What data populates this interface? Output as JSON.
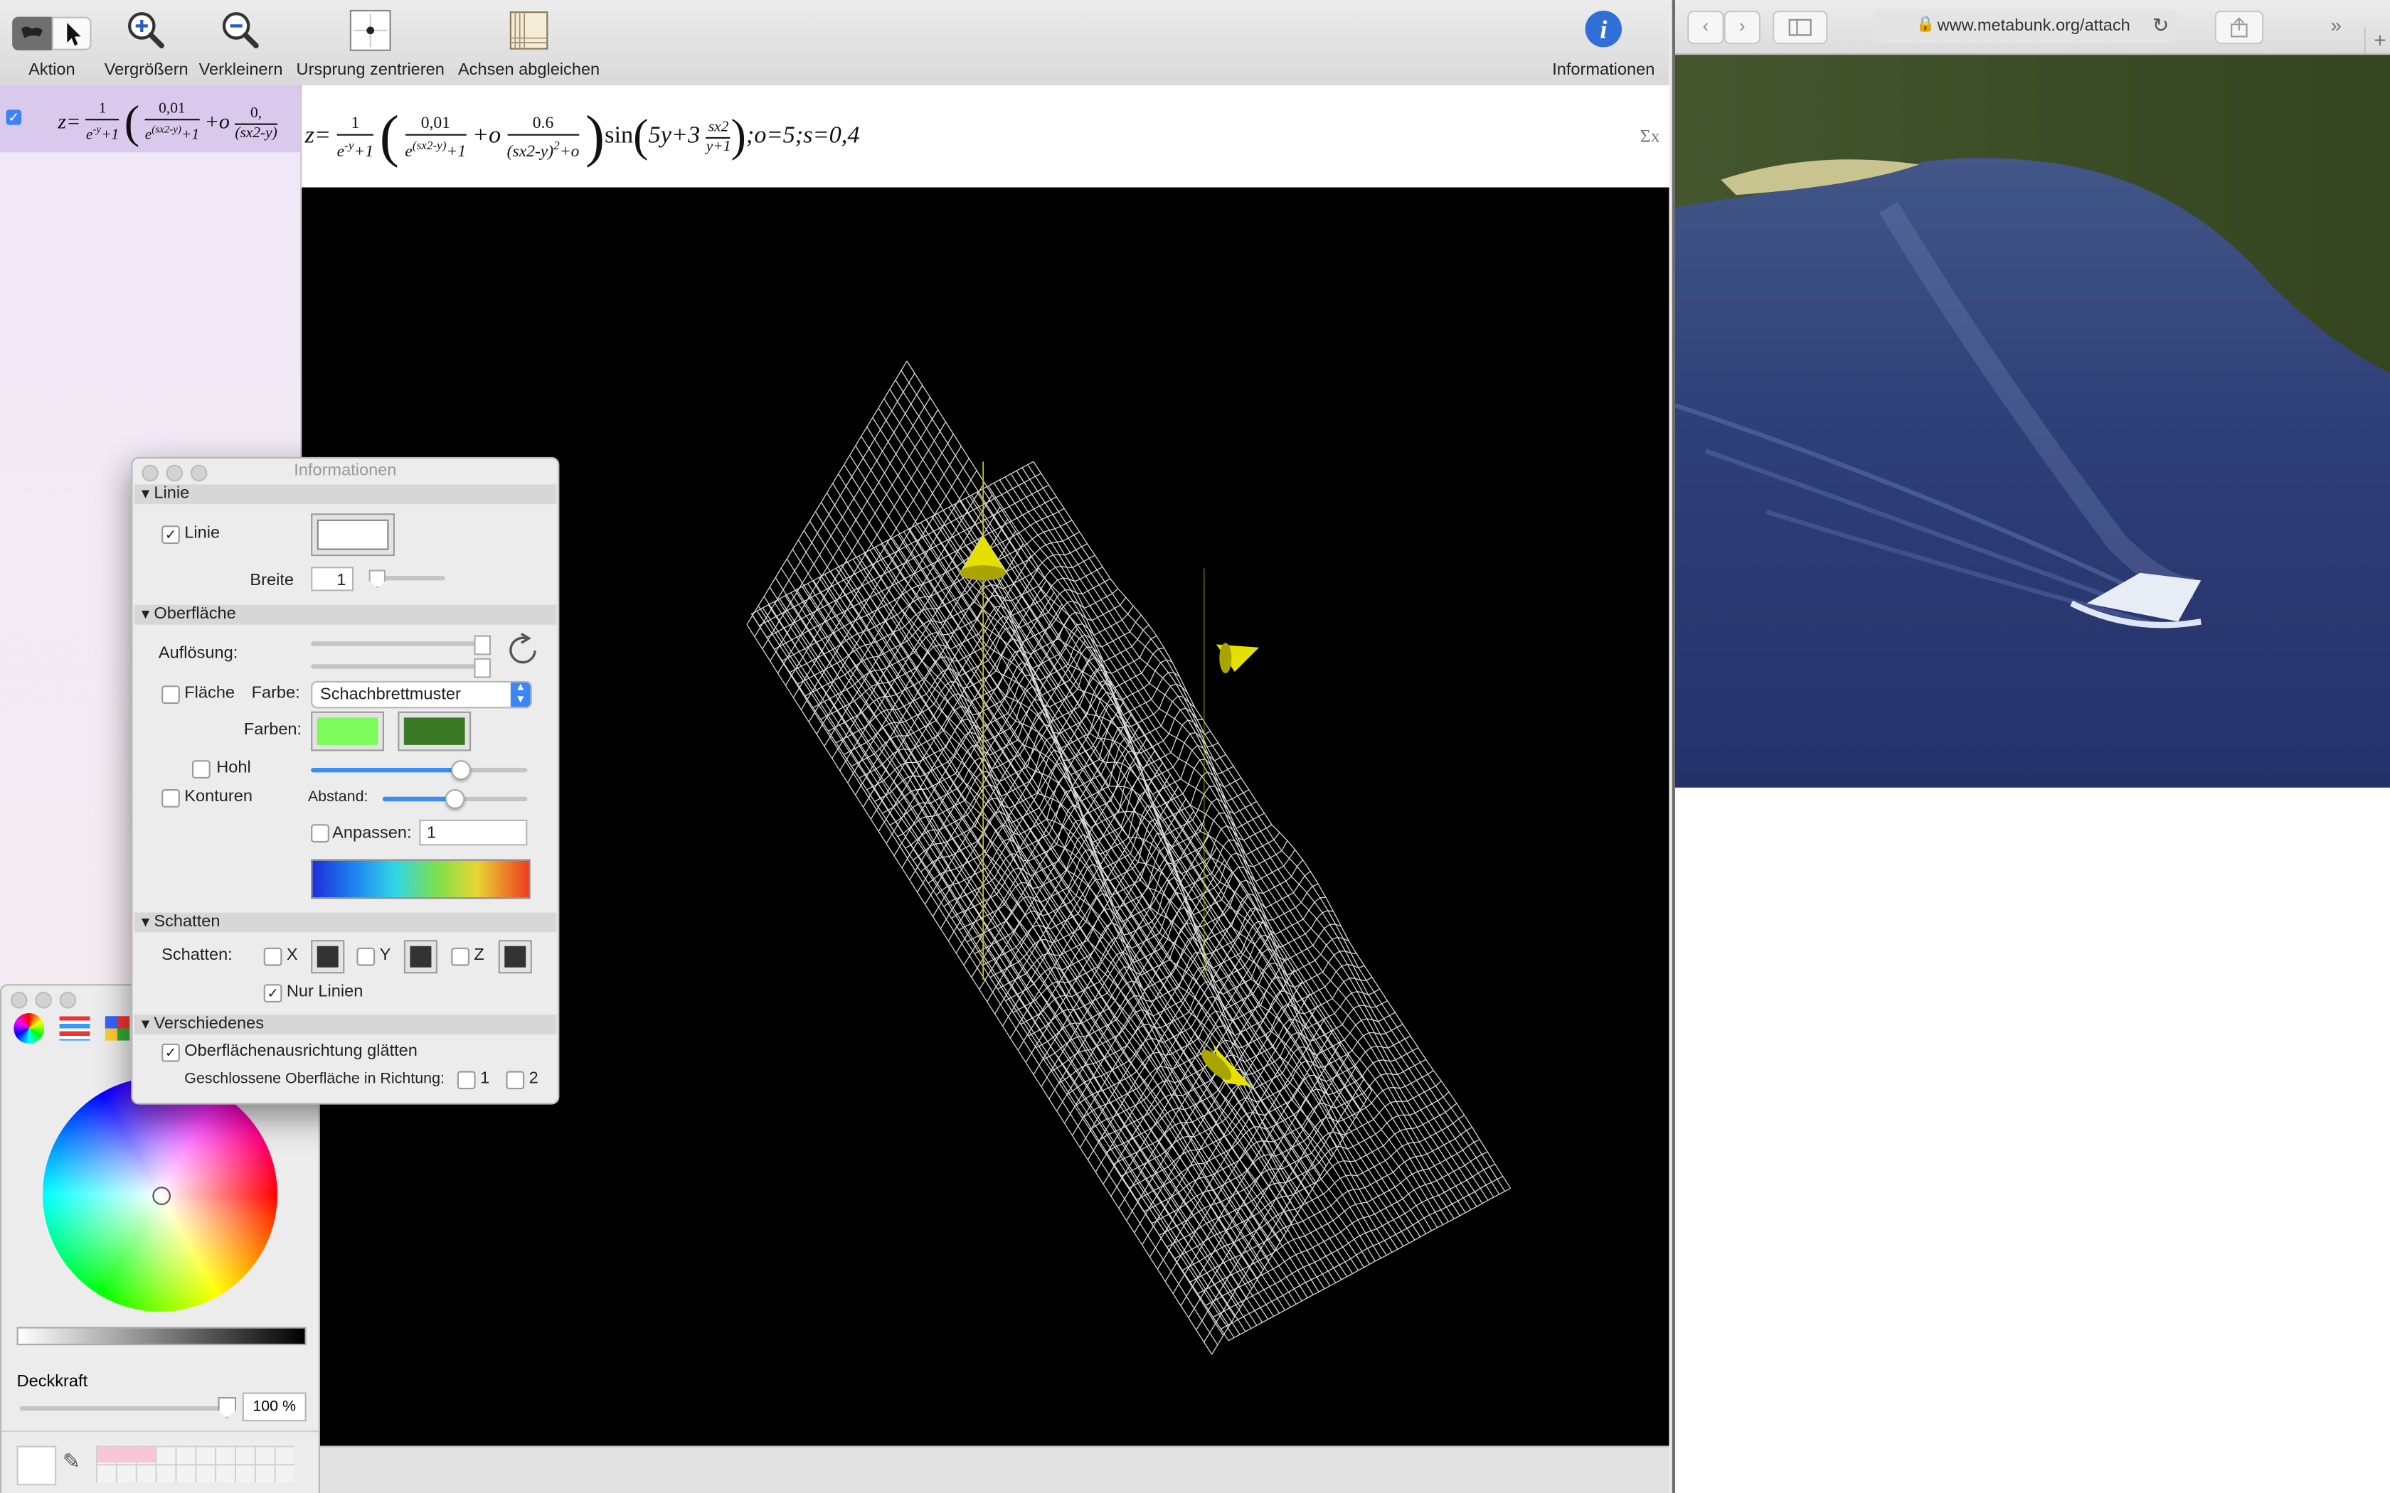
{
  "toolbar": {
    "aktion_label": "Aktion",
    "zoom_in_label": "Vergrößern",
    "zoom_out_label": "Verkleinern",
    "center_origin_label": "Ursprung zentrieren",
    "match_axes_label": "Achsen abgleichen",
    "info_label": "Informationen"
  },
  "equation": {
    "checked": "✓",
    "z": "z",
    "eq": "=",
    "one": "1",
    "exp_base": "e",
    "exp_sup": "-y",
    "plus_one": "+1",
    "num1": "0,01",
    "den1_base": "e",
    "den1_sup": "(sx2-y)",
    "den1_tail": "+1",
    "plus_o": "+o",
    "num2": "0.6",
    "den2": "(sx2-y)",
    "den2_sup": "2",
    "den2_tail": "+o",
    "sin": "sin",
    "arg_a": "5y+3",
    "arg_num": "sx2",
    "arg_den": "y+1",
    "params": ";o=5;s=0,4",
    "sigma": "Σx",
    "sidebar_num2": "0,"
  },
  "browser": {
    "url": "www.metabunk.org/attach"
  },
  "info_panel": {
    "title": "Informationen",
    "line_section": "Linie",
    "line_checkbox_label": "Linie",
    "width_label": "Breite",
    "width_value": "1",
    "surface_section": "Oberfläche",
    "resolution_label": "Auflösung:",
    "surface_checkbox_label": "Fläche",
    "color_label": "Farbe:",
    "color_value": "Schachbrettmuster",
    "colors_label": "Farben:",
    "color1": "#7dfb5a",
    "color2": "#3a7a24",
    "hollow_label": "Hohl",
    "contours_label": "Konturen",
    "spacing_label": "Abstand:",
    "fit_label": "Anpassen:",
    "fit_value": "1",
    "shadows_section": "Schatten",
    "shadows_label": "Schatten:",
    "shadow_x": "X",
    "shadow_y": "Y",
    "shadow_z": "Z",
    "lines_only_label": "Nur Linien",
    "misc_section": "Verschiedenes",
    "smooth_label": "Oberflächenausrichtung glätten",
    "closed_label": "Geschlossene Oberfläche in Richtung:",
    "dir1": "1",
    "dir2": "2"
  },
  "colors_panel": {
    "opacity_label": "Deckkraft",
    "opacity_value": "100 %"
  }
}
